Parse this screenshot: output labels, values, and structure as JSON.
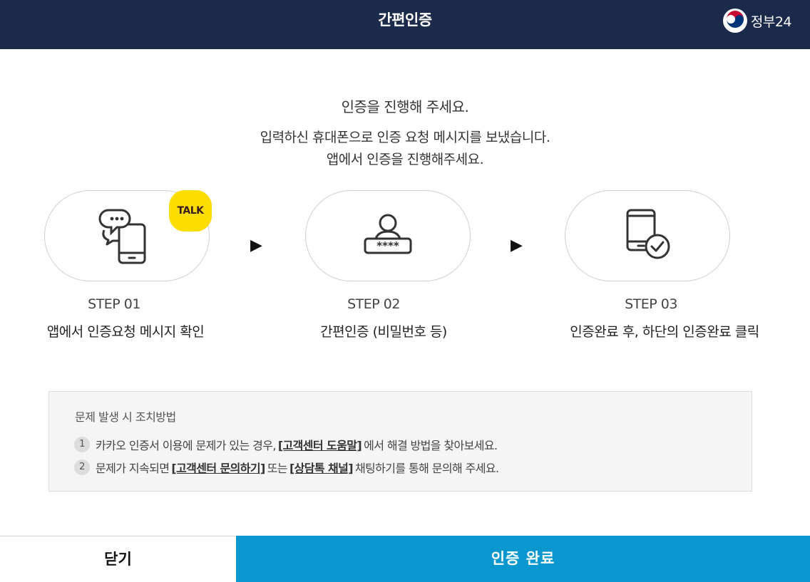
{
  "header": {
    "title": "간편인증",
    "logo_text": "정부24"
  },
  "message": {
    "line1": "인증을 진행해 주세요.",
    "line2": "입력하신 휴대폰으로 인증 요청 메시지를 보냈습니다.",
    "line3": "앱에서 인증을 진행해주세요."
  },
  "steps": [
    {
      "label": "STEP 01",
      "desc": "앱에서 인증요청 메시지 확인",
      "icon": "phone-chat-icon"
    },
    {
      "label": "STEP 02",
      "desc": "간편인증 (비밀번호 등)",
      "icon": "user-password-icon"
    },
    {
      "label": "STEP 03",
      "desc": "인증완료 후, 하단의 인증완료 클릭",
      "icon": "phone-check-icon"
    }
  ],
  "talk_badge": "TALK",
  "arrow_glyph": "▶",
  "notice": {
    "title": "문제 발생 시 조치방법",
    "item1": {
      "num": "1",
      "text_a": "카카오 인증서 이용에 문제가 있는 경우,",
      "link": "[고객센터 도움말]",
      "text_b": "에서 해결 방법을 찾아보세요."
    },
    "item2": {
      "num": "2",
      "text_a": "문제가 지속되면",
      "link_a": "[고객센터 문의하기]",
      "text_b": "또는",
      "link_b": "[상담톡 채널]",
      "text_c": "채팅하기를 통해 문의해 주세요."
    }
  },
  "buttons": {
    "close": "닫기",
    "done": "인증 완료"
  },
  "colors": {
    "header_bg": "#1b2a4a",
    "primary": "#0a97cf",
    "kakao_yellow": "#fddc00"
  }
}
